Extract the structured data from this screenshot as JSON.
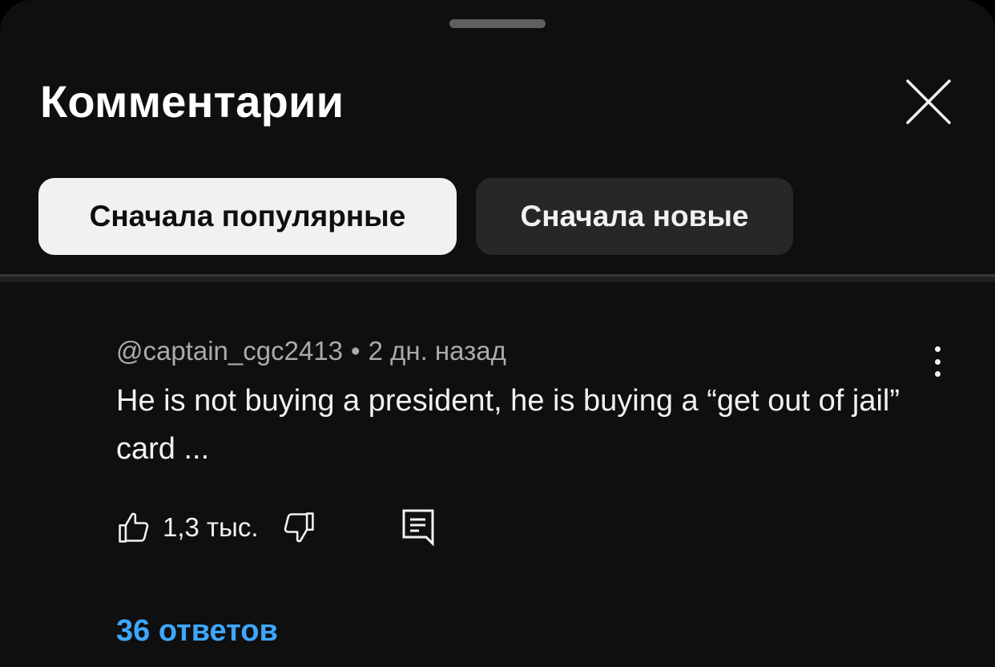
{
  "sheet": {
    "title": "Комментарии"
  },
  "sort_chips": [
    {
      "label": "Сначала популярные",
      "selected": true
    },
    {
      "label": "Сначала новые",
      "selected": false
    }
  ],
  "comment": {
    "author": "@captain_cgc2413",
    "separator": "•",
    "time": "2 дн. назад",
    "text": "He is not buying a president, he is buying a “get out of jail” card ...",
    "like_count": "1,3 тыс.",
    "replies_label": "36 ответов"
  },
  "colors": {
    "background": "#0f0f0f",
    "chip_active": "#f1f1f1",
    "chip_inactive": "#272727",
    "link_blue": "#3ea6ff",
    "meta_gray": "#aaaaaa"
  },
  "icons": [
    "close-icon",
    "more-vert-icon",
    "thumb-up-icon",
    "thumb-down-icon",
    "reply-comment-icon"
  ]
}
